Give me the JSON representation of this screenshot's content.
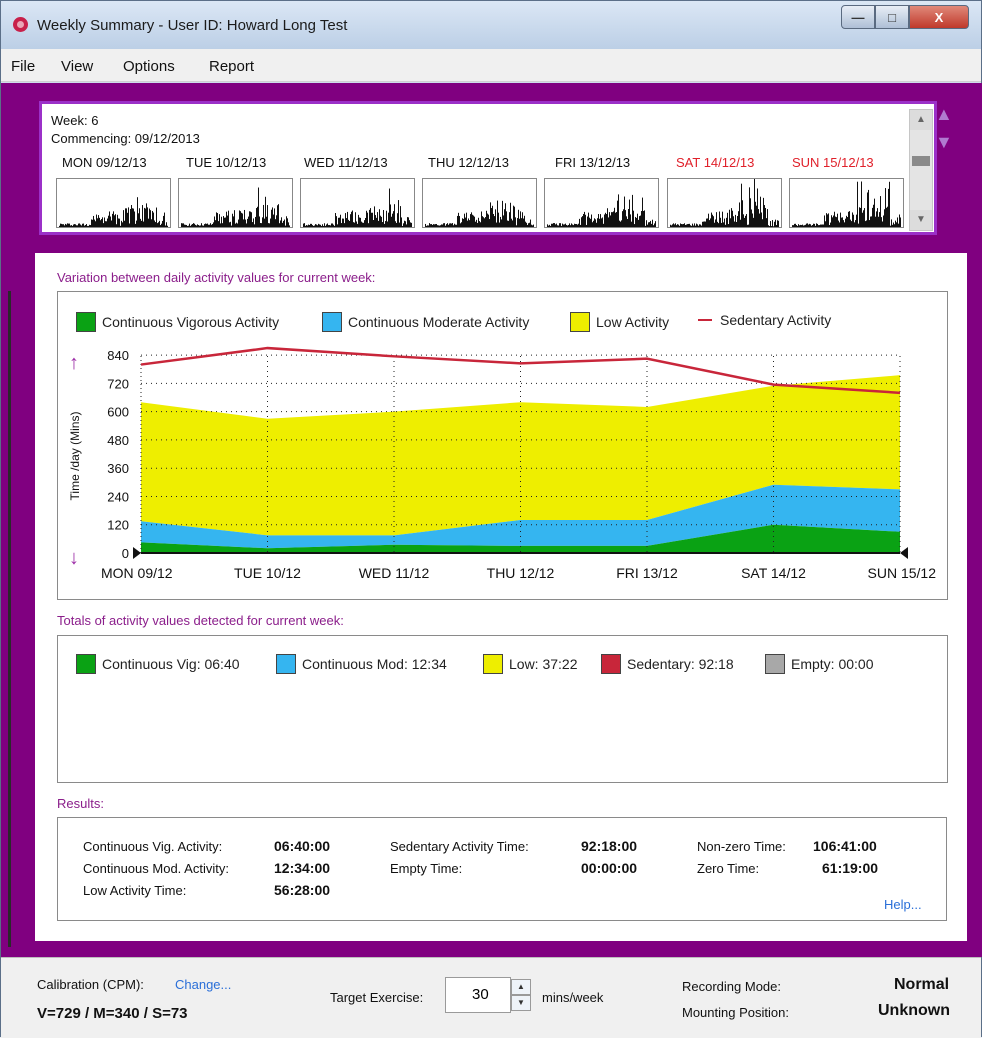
{
  "window": {
    "title": "Weekly Summary - User ID: Howard Long Test",
    "buttons": {
      "minimize": "—",
      "maximize": "□",
      "close": "X"
    }
  },
  "menu": [
    "File",
    "View",
    "Options",
    "Report"
  ],
  "week": {
    "week_label": "Week: 6",
    "commencing": "Commencing: 09/12/2013",
    "days": [
      {
        "label": "MON 09/12/13",
        "weekend": false
      },
      {
        "label": "TUE 10/12/13",
        "weekend": false
      },
      {
        "label": "WED 11/12/13",
        "weekend": false
      },
      {
        "label": "THU 12/12/13",
        "weekend": false
      },
      {
        "label": "FRI 13/12/13",
        "weekend": false
      },
      {
        "label": "SAT 14/12/13",
        "weekend": true
      },
      {
        "label": "SUN 15/12/13",
        "weekend": true
      }
    ]
  },
  "variation": {
    "section_title": "Variation between daily activity values for current week:",
    "legend": {
      "vigorous": "Continuous Vigorous Activity",
      "moderate": "Continuous Moderate Activity",
      "low": "Low Activity",
      "sedentary": "Sedentary Activity"
    },
    "ylabel": "Time /day (Mins)",
    "up_arrow": "↑",
    "down_arrow": "↓"
  },
  "totals": {
    "section_title": "Totals of activity values detected for current week:",
    "legend": {
      "vig": "Continuous Vig: 06:40",
      "mod": "Continuous Mod: 12:34",
      "low": "Low: 37:22",
      "sedentary": "Sedentary: 92:18",
      "empty": "Empty: 00:00"
    },
    "bar_values_hours": {
      "vig": 6.67,
      "mod": 12.57,
      "low": 37.37,
      "sedentary": 92.3,
      "empty": 0
    }
  },
  "results": {
    "section_title": "Results:",
    "vig_label": "Continuous Vig. Activity:",
    "vig_value": "06:40:00",
    "mod_label": "Continuous Mod. Activity:",
    "mod_value": "12:34:00",
    "low_label": "Low Activity Time:",
    "low_value": "56:28:00",
    "sed_label": "Sedentary Activity Time:",
    "sed_value": "92:18:00",
    "empty_label": "Empty Time:",
    "empty_value": "00:00:00",
    "nonzero_label": "Non-zero Time:",
    "nonzero_value": "106:41:00",
    "zero_label": "Zero Time:",
    "zero_value": "61:19:00",
    "help": "Help..."
  },
  "status": {
    "calibration_label": "Calibration (CPM):",
    "change_link": "Change...",
    "calibration_values": "V=729 / M=340 / S=73",
    "target_label": "Target Exercise:",
    "target_value": "30",
    "target_unit": "mins/week",
    "recording_label": "Recording Mode:",
    "recording_value": "Normal",
    "mounting_label": "Mounting Position:",
    "mounting_value": "Unknown"
  },
  "colors": {
    "vigorous": "#0aa214",
    "moderate": "#35b5f0",
    "low": "#eeee00",
    "sedentary": "#c8263a",
    "empty": "#a8a8a8",
    "frame": "#800080"
  },
  "chart_data": {
    "type": "area",
    "categories": [
      "MON 09/12",
      "TUE 10/12",
      "WED 11/12",
      "THU 12/12",
      "FRI 13/12",
      "SAT 14/12",
      "SUN 15/12"
    ],
    "ylim": [
      0,
      900
    ],
    "yticks": [
      0,
      120,
      240,
      360,
      480,
      600,
      720,
      840
    ],
    "grid": true,
    "legend_position": "top",
    "series": [
      {
        "name": "Continuous Vigorous Activity",
        "kind": "stacked-area",
        "values": [
          45,
          20,
          35,
          30,
          30,
          120,
          90
        ]
      },
      {
        "name": "Continuous Moderate Activity",
        "kind": "stacked-area",
        "values": [
          90,
          55,
          40,
          110,
          110,
          170,
          180
        ]
      },
      {
        "name": "Low Activity",
        "kind": "stacked-area",
        "values": [
          505,
          495,
          525,
          500,
          480,
          420,
          485
        ]
      },
      {
        "name": "Sedentary Activity",
        "kind": "line",
        "values": [
          800,
          870,
          835,
          805,
          825,
          715,
          680
        ]
      }
    ]
  }
}
